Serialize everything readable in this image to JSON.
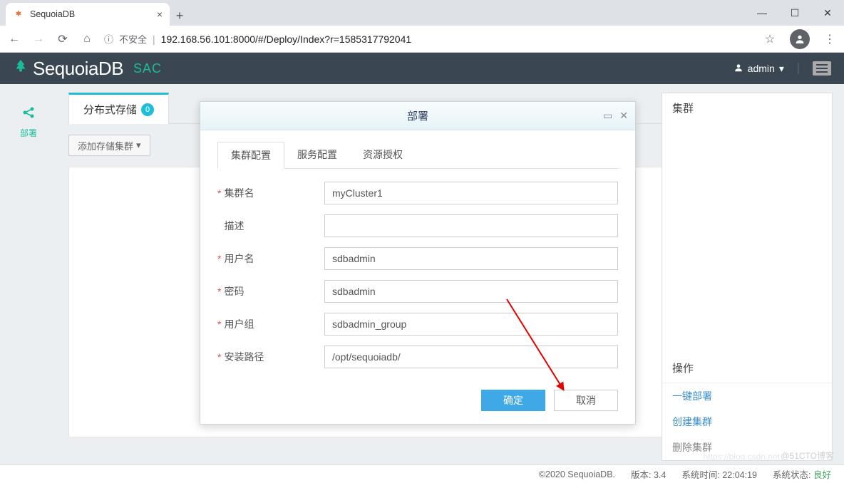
{
  "browser": {
    "tab_title": "SequoiaDB",
    "insecure_label": "不安全",
    "url": "192.168.56.101:8000/#/Deploy/Index?r=1585317792041"
  },
  "header": {
    "brand": "SequoiaDB",
    "sub": "SAC",
    "user": "admin"
  },
  "sidebar": {
    "deploy_label": "部署"
  },
  "page_tabs": {
    "storage": "分布式存储",
    "storage_count": "0",
    "right_peek": "集群"
  },
  "toolbar": {
    "add_cluster": "添加存储集群"
  },
  "ops": {
    "title": "操作",
    "a": "一键部署",
    "b": "创建集群",
    "c": "删除集群"
  },
  "modal": {
    "title": "部署",
    "tabs": {
      "t1": "集群配置",
      "t2": "服务配置",
      "t3": "资源授权"
    },
    "labels": {
      "cluster_name": "集群名",
      "desc": "描述",
      "username": "用户名",
      "password": "密码",
      "group": "用户组",
      "install_path": "安装路径"
    },
    "values": {
      "cluster_name": "myCluster1",
      "desc": "",
      "username": "sdbadmin",
      "password": "sdbadmin",
      "group": "sdbadmin_group",
      "install_path": "/opt/sequoiadb/"
    },
    "ok": "确定",
    "cancel": "取消"
  },
  "footer": {
    "copyright": "©2020 SequoiaDB.",
    "version_label": "版本:",
    "version": "3.4",
    "time_label": "系统时间:",
    "time": "22:04:19",
    "status_label": "系统状态:",
    "status": "良好"
  },
  "watermark": "@51CTO博客",
  "watermark2": "https://blog.csdn.net"
}
